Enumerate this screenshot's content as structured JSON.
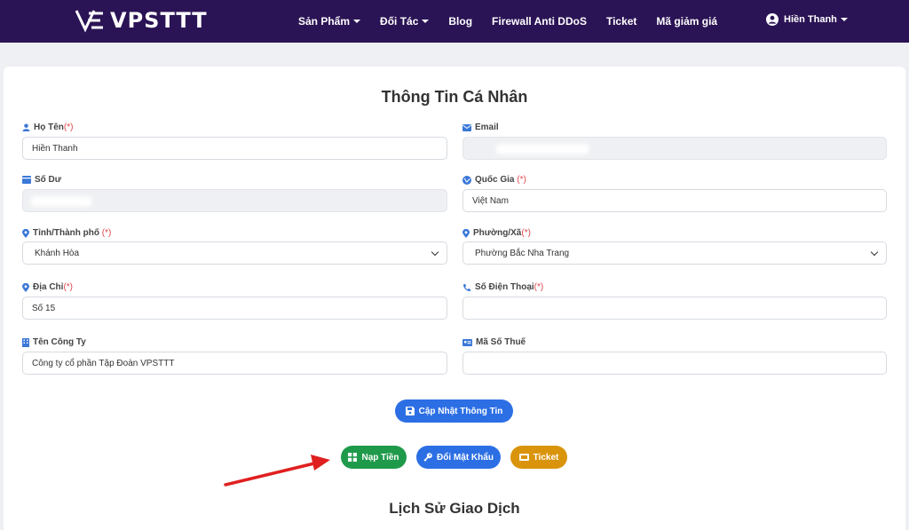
{
  "navbar": {
    "brand": "VPSTTT",
    "items": [
      {
        "label": "Sản Phẩm",
        "dropdown": true
      },
      {
        "label": "Đối Tác",
        "dropdown": true
      },
      {
        "label": "Blog",
        "dropdown": false
      },
      {
        "label": "Firewall Anti DDoS",
        "dropdown": false
      },
      {
        "label": "Ticket",
        "dropdown": false
      },
      {
        "label": "Mã giảm giá",
        "dropdown": false
      }
    ],
    "user_name": "Hiền Thanh"
  },
  "profile": {
    "title": "Thông Tin Cá Nhân",
    "full_name_label": "Họ Tên",
    "full_name_value": "Hiền Thanh",
    "email_label": "Email",
    "balance_label": "Số Dư",
    "country_label": "Quốc Gia",
    "country_value": "Việt Nam",
    "province_label": "Tỉnh/Thành phố",
    "province_value": "Khánh Hòa",
    "ward_label": "Phường/Xã",
    "ward_value": "Phường Bắc Nha Trang",
    "address_label": "Địa Chỉ",
    "address_value": "Số 15",
    "phone_label": "Số Điện Thoại",
    "phone_value": "",
    "company_label": "Tên Công Ty",
    "company_value": "Công ty cổ phần Tập Đoàn VPSTTT",
    "tax_label": "Mã Số Thuế",
    "tax_value": "",
    "required_mark": "(*)",
    "update_button": "Cập Nhật Thông Tin"
  },
  "actions": {
    "deposit": "Nạp Tiền",
    "change_password": "Đổi Mật Khẩu",
    "ticket": "Ticket"
  },
  "history": {
    "title": "Lịch Sử Giao Dịch"
  },
  "colors": {
    "navbar": "#2b1455",
    "primary": "#2c6fe4",
    "success": "#1f9a4b",
    "warning": "#d9940b",
    "icon_blue": "#3b78d8",
    "required": "#e2444b",
    "arrow": "#e02020"
  },
  "icons": {
    "user": "user-icon",
    "email": "envelope-icon",
    "balance": "wallet-icon",
    "country": "globe-icon",
    "location": "map-marker-icon",
    "phone": "phone-icon",
    "company": "building-icon",
    "tax": "id-card-icon",
    "save": "save-icon",
    "deposit": "grid-icon",
    "password": "key-icon",
    "ticket": "ticket-icon"
  }
}
